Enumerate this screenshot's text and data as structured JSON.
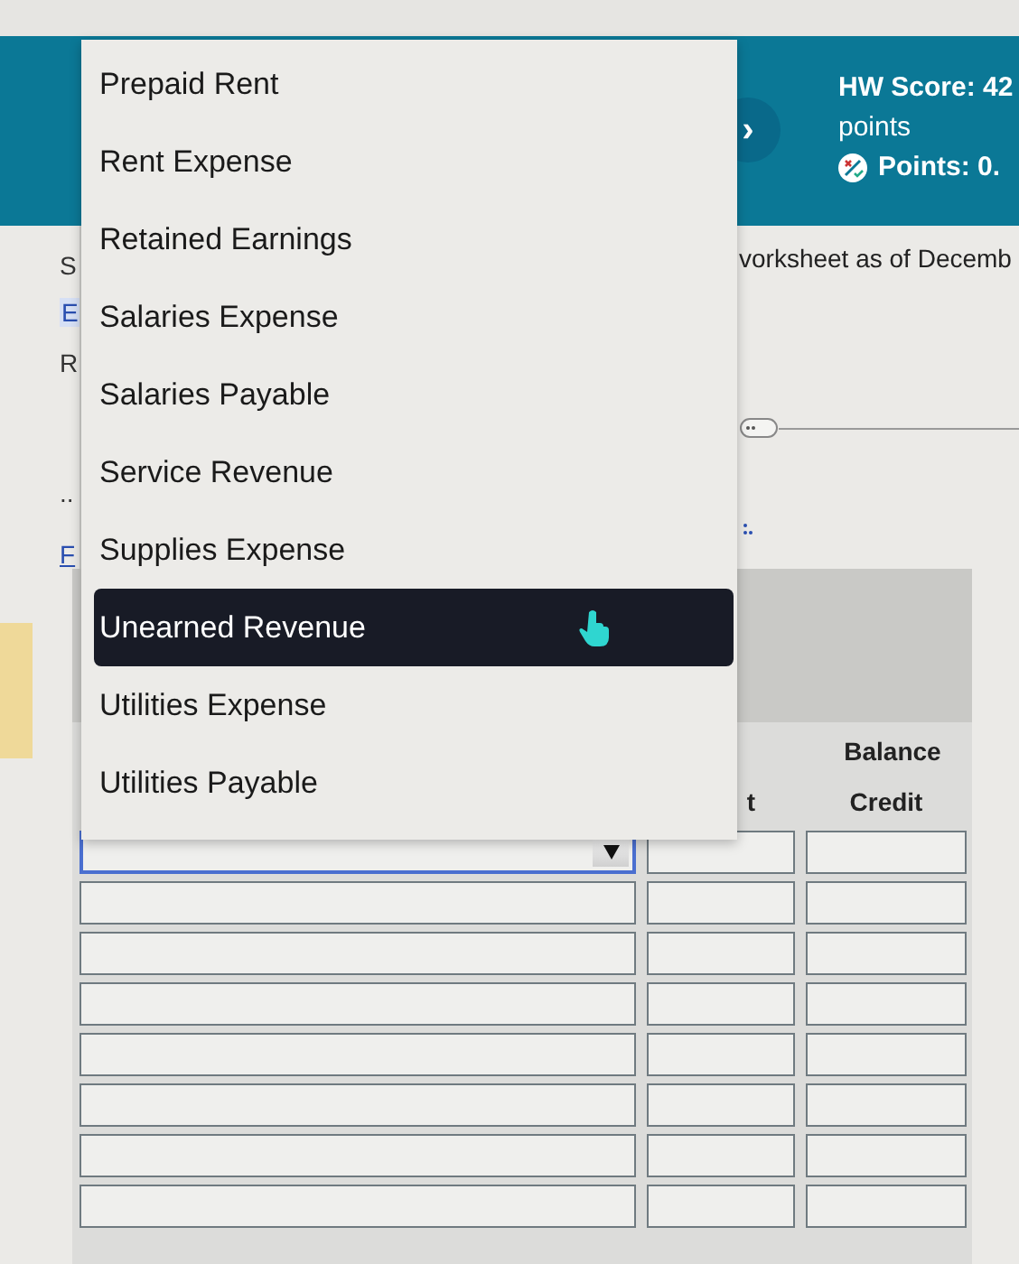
{
  "header": {
    "next_label": "›",
    "hw_score": "HW Score: 42",
    "points_unit": "points",
    "points": "Points: 0."
  },
  "left_fragments": [
    {
      "text": "S",
      "kind": "plain"
    },
    {
      "text": "E",
      "kind": "boxed-link"
    },
    {
      "text": "R",
      "kind": "plain"
    },
    {
      "text": "..",
      "kind": "plain"
    },
    {
      "text": "F",
      "kind": "link"
    }
  ],
  "instruction_fragment": "vorksheet as of Decemb",
  "table": {
    "balance_heading": "Balance",
    "columns": [
      "t",
      "Credit"
    ],
    "rows": [
      {
        "kind": "select",
        "focused": true
      },
      {
        "kind": "input",
        "focused": false
      },
      {
        "kind": "input",
        "focused": false
      },
      {
        "kind": "input",
        "focused": false
      },
      {
        "kind": "input",
        "focused": false
      },
      {
        "kind": "input",
        "focused": false
      },
      {
        "kind": "input",
        "focused": false
      },
      {
        "kind": "input",
        "focused": false
      }
    ]
  },
  "dropdown": {
    "options": [
      {
        "label": "Prepaid Rent",
        "selected": false
      },
      {
        "label": "Rent Expense",
        "selected": false
      },
      {
        "label": "Retained Earnings",
        "selected": false
      },
      {
        "label": "Salaries Expense",
        "selected": false
      },
      {
        "label": "Salaries Payable",
        "selected": false
      },
      {
        "label": "Service Revenue",
        "selected": false
      },
      {
        "label": "Supplies Expense",
        "selected": false
      },
      {
        "label": "Unearned Revenue",
        "selected": true
      },
      {
        "label": "Utilities Expense",
        "selected": false
      },
      {
        "label": "Utilities Payable",
        "selected": false
      }
    ]
  }
}
